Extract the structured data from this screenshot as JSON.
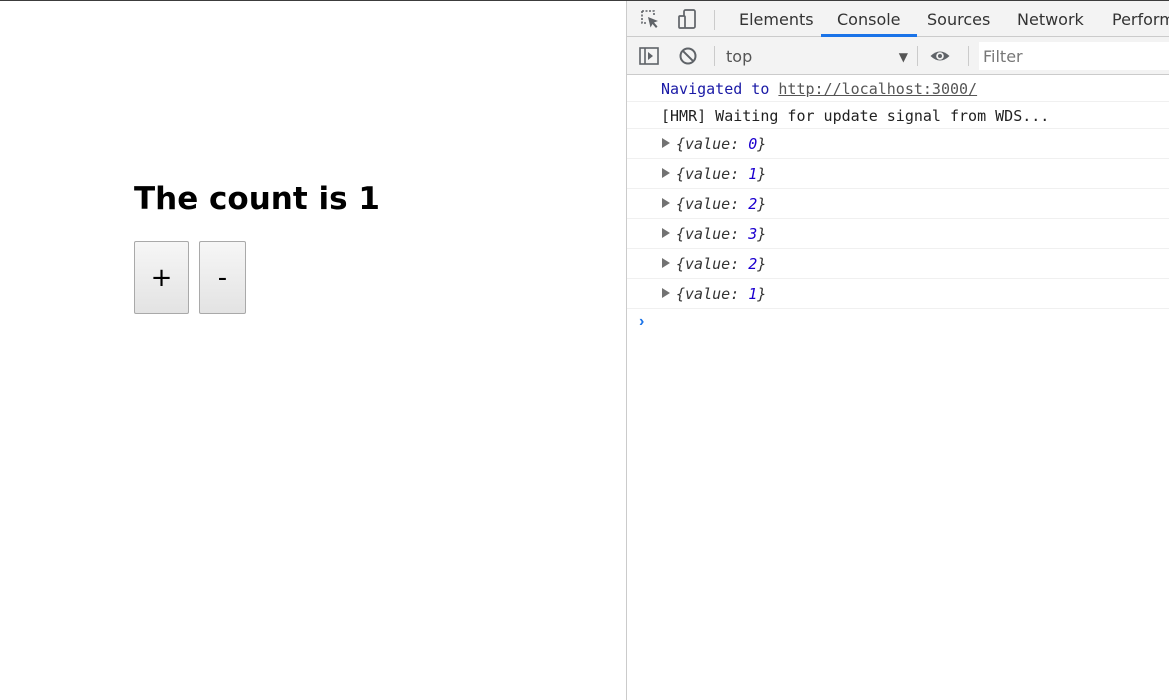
{
  "app": {
    "heading": "The count is 1",
    "buttons": {
      "plus": "+",
      "minus": "-"
    }
  },
  "devtools": {
    "toolbar_icons": [
      "inspect-element-icon",
      "device-toolbar-icon"
    ],
    "tabs": [
      {
        "label": "Elements",
        "active": false
      },
      {
        "label": "Console",
        "active": true
      },
      {
        "label": "Sources",
        "active": false
      },
      {
        "label": "Network",
        "active": false
      },
      {
        "label": "Perform",
        "active": false
      }
    ],
    "filterbar": {
      "context": "top",
      "filter_placeholder": "Filter"
    },
    "console": {
      "nav_prefix": "Navigated to",
      "nav_url": "http://localhost:3000/",
      "hmr": "[HMR] Waiting for update signal from WDS...",
      "objects": [
        {
          "key": "value",
          "value": "0"
        },
        {
          "key": "value",
          "value": "1"
        },
        {
          "key": "value",
          "value": "2"
        },
        {
          "key": "value",
          "value": "3"
        },
        {
          "key": "value",
          "value": "2"
        },
        {
          "key": "value",
          "value": "1"
        }
      ],
      "prompt": "›"
    },
    "colors": {
      "accent": "#1a73e8",
      "number": "#1c00cf",
      "nav": "#1a1aa6"
    }
  }
}
